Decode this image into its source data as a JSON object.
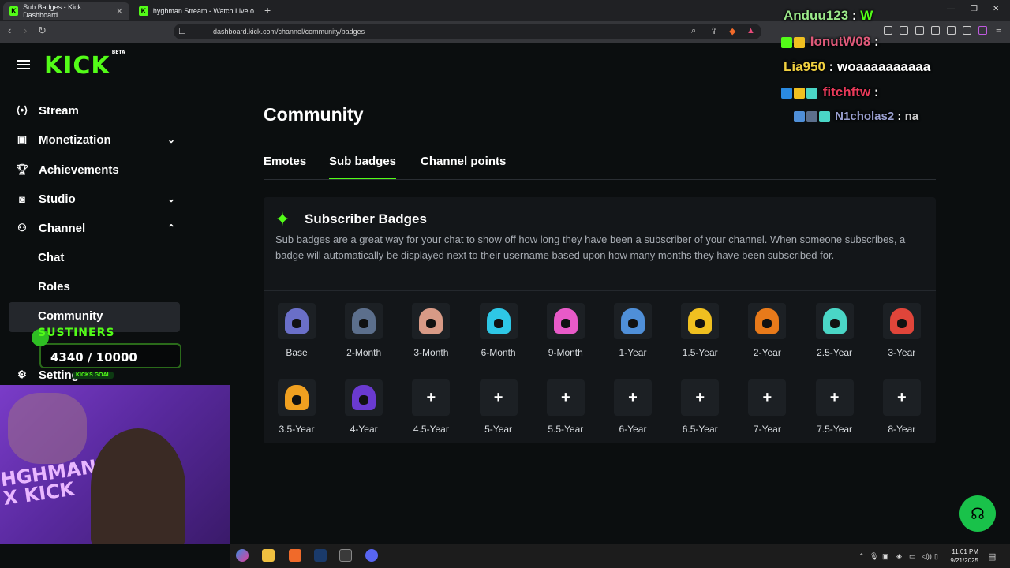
{
  "browser": {
    "tabs": [
      {
        "title": "Sub Badges - Kick Dashboard",
        "active": true
      },
      {
        "title": "hyghman Stream - Watch Live on Kic",
        "active": false
      }
    ],
    "url": "dashboard.kick.com/channel/community/badges"
  },
  "brand": {
    "logo": "KICK",
    "beta": "BETA",
    "accent": "#53fc18"
  },
  "sidebar": {
    "items": [
      {
        "label": "Stream",
        "icon": "stream-icon"
      },
      {
        "label": "Monetization",
        "icon": "wallet-icon",
        "chevron": "down"
      },
      {
        "label": "Achievements",
        "icon": "trophy-icon"
      },
      {
        "label": "Studio",
        "icon": "camera-icon",
        "chevron": "down"
      },
      {
        "label": "Channel",
        "icon": "users-icon",
        "chevron": "up"
      }
    ],
    "sub_items": [
      "Chat",
      "Roles",
      "Community"
    ],
    "settings_label": "Settings"
  },
  "overlay_goal": {
    "title": "SUSTINERS",
    "count": "4340 / 10000",
    "label": "KICKS GOAL",
    "progress": 0.434
  },
  "webcam": {
    "text": "HGHMAN X KICK"
  },
  "main": {
    "title": "Community",
    "tabs": [
      "Emotes",
      "Sub badges",
      "Channel points"
    ],
    "active_tab": "Sub badges"
  },
  "panel": {
    "title": "Subscriber Badges",
    "description": "Sub badges are a great way for your chat to show off how long they have been a subscriber of your channel. When someone subscribes, a badge will automatically be displayed next to their username based upon how many months they have been subscribed for."
  },
  "badges": [
    {
      "name": "Base",
      "color": "#6a6fc8",
      "set": true
    },
    {
      "name": "2-Month",
      "color": "#5c6f8c",
      "set": true
    },
    {
      "name": "3-Month",
      "color": "#d89a86",
      "set": true
    },
    {
      "name": "6-Month",
      "color": "#2ec7e6",
      "set": true
    },
    {
      "name": "9-Month",
      "color": "#e85ac8",
      "set": true
    },
    {
      "name": "1-Year",
      "color": "#4f8fd8",
      "set": true
    },
    {
      "name": "1.5-Year",
      "color": "#f0c020",
      "set": true
    },
    {
      "name": "2-Year",
      "color": "#e87a1a",
      "set": true
    },
    {
      "name": "2.5-Year",
      "color": "#4ad6c6",
      "set": true
    },
    {
      "name": "3-Year",
      "color": "#e0453a",
      "set": true
    },
    {
      "name": "3.5-Year",
      "color": "#f0a020",
      "set": true
    },
    {
      "name": "4-Year",
      "color": "#6a3ad0",
      "set": true
    },
    {
      "name": "4.5-Year",
      "set": false
    },
    {
      "name": "5-Year",
      "set": false
    },
    {
      "name": "5.5-Year",
      "set": false
    },
    {
      "name": "6-Year",
      "set": false
    },
    {
      "name": "6.5-Year",
      "set": false
    },
    {
      "name": "7-Year",
      "set": false
    },
    {
      "name": "7.5-Year",
      "set": false
    },
    {
      "name": "8-Year",
      "set": false
    }
  ],
  "chat_overlay": [
    {
      "user": "Anduu123",
      "sep": " : ",
      "msg": "W",
      "color": "#9be88a"
    },
    {
      "user": "IonutW08",
      "sep": " : ",
      "msg": "",
      "color": "#e05a7a"
    },
    {
      "user": "Lia950",
      "sep": " : ",
      "msg": "woaaaaaaaaaa",
      "color": "#f0d040"
    },
    {
      "user": "fitchftw",
      "sep": " : ",
      "msg": "",
      "color": "#e83a5a"
    },
    {
      "user": "N1cholas2",
      "sep": " : ",
      "msg": "na",
      "color": "#9aa0d0"
    }
  ],
  "clock": {
    "time": "11:01 PM",
    "date": "9/21/2025"
  }
}
